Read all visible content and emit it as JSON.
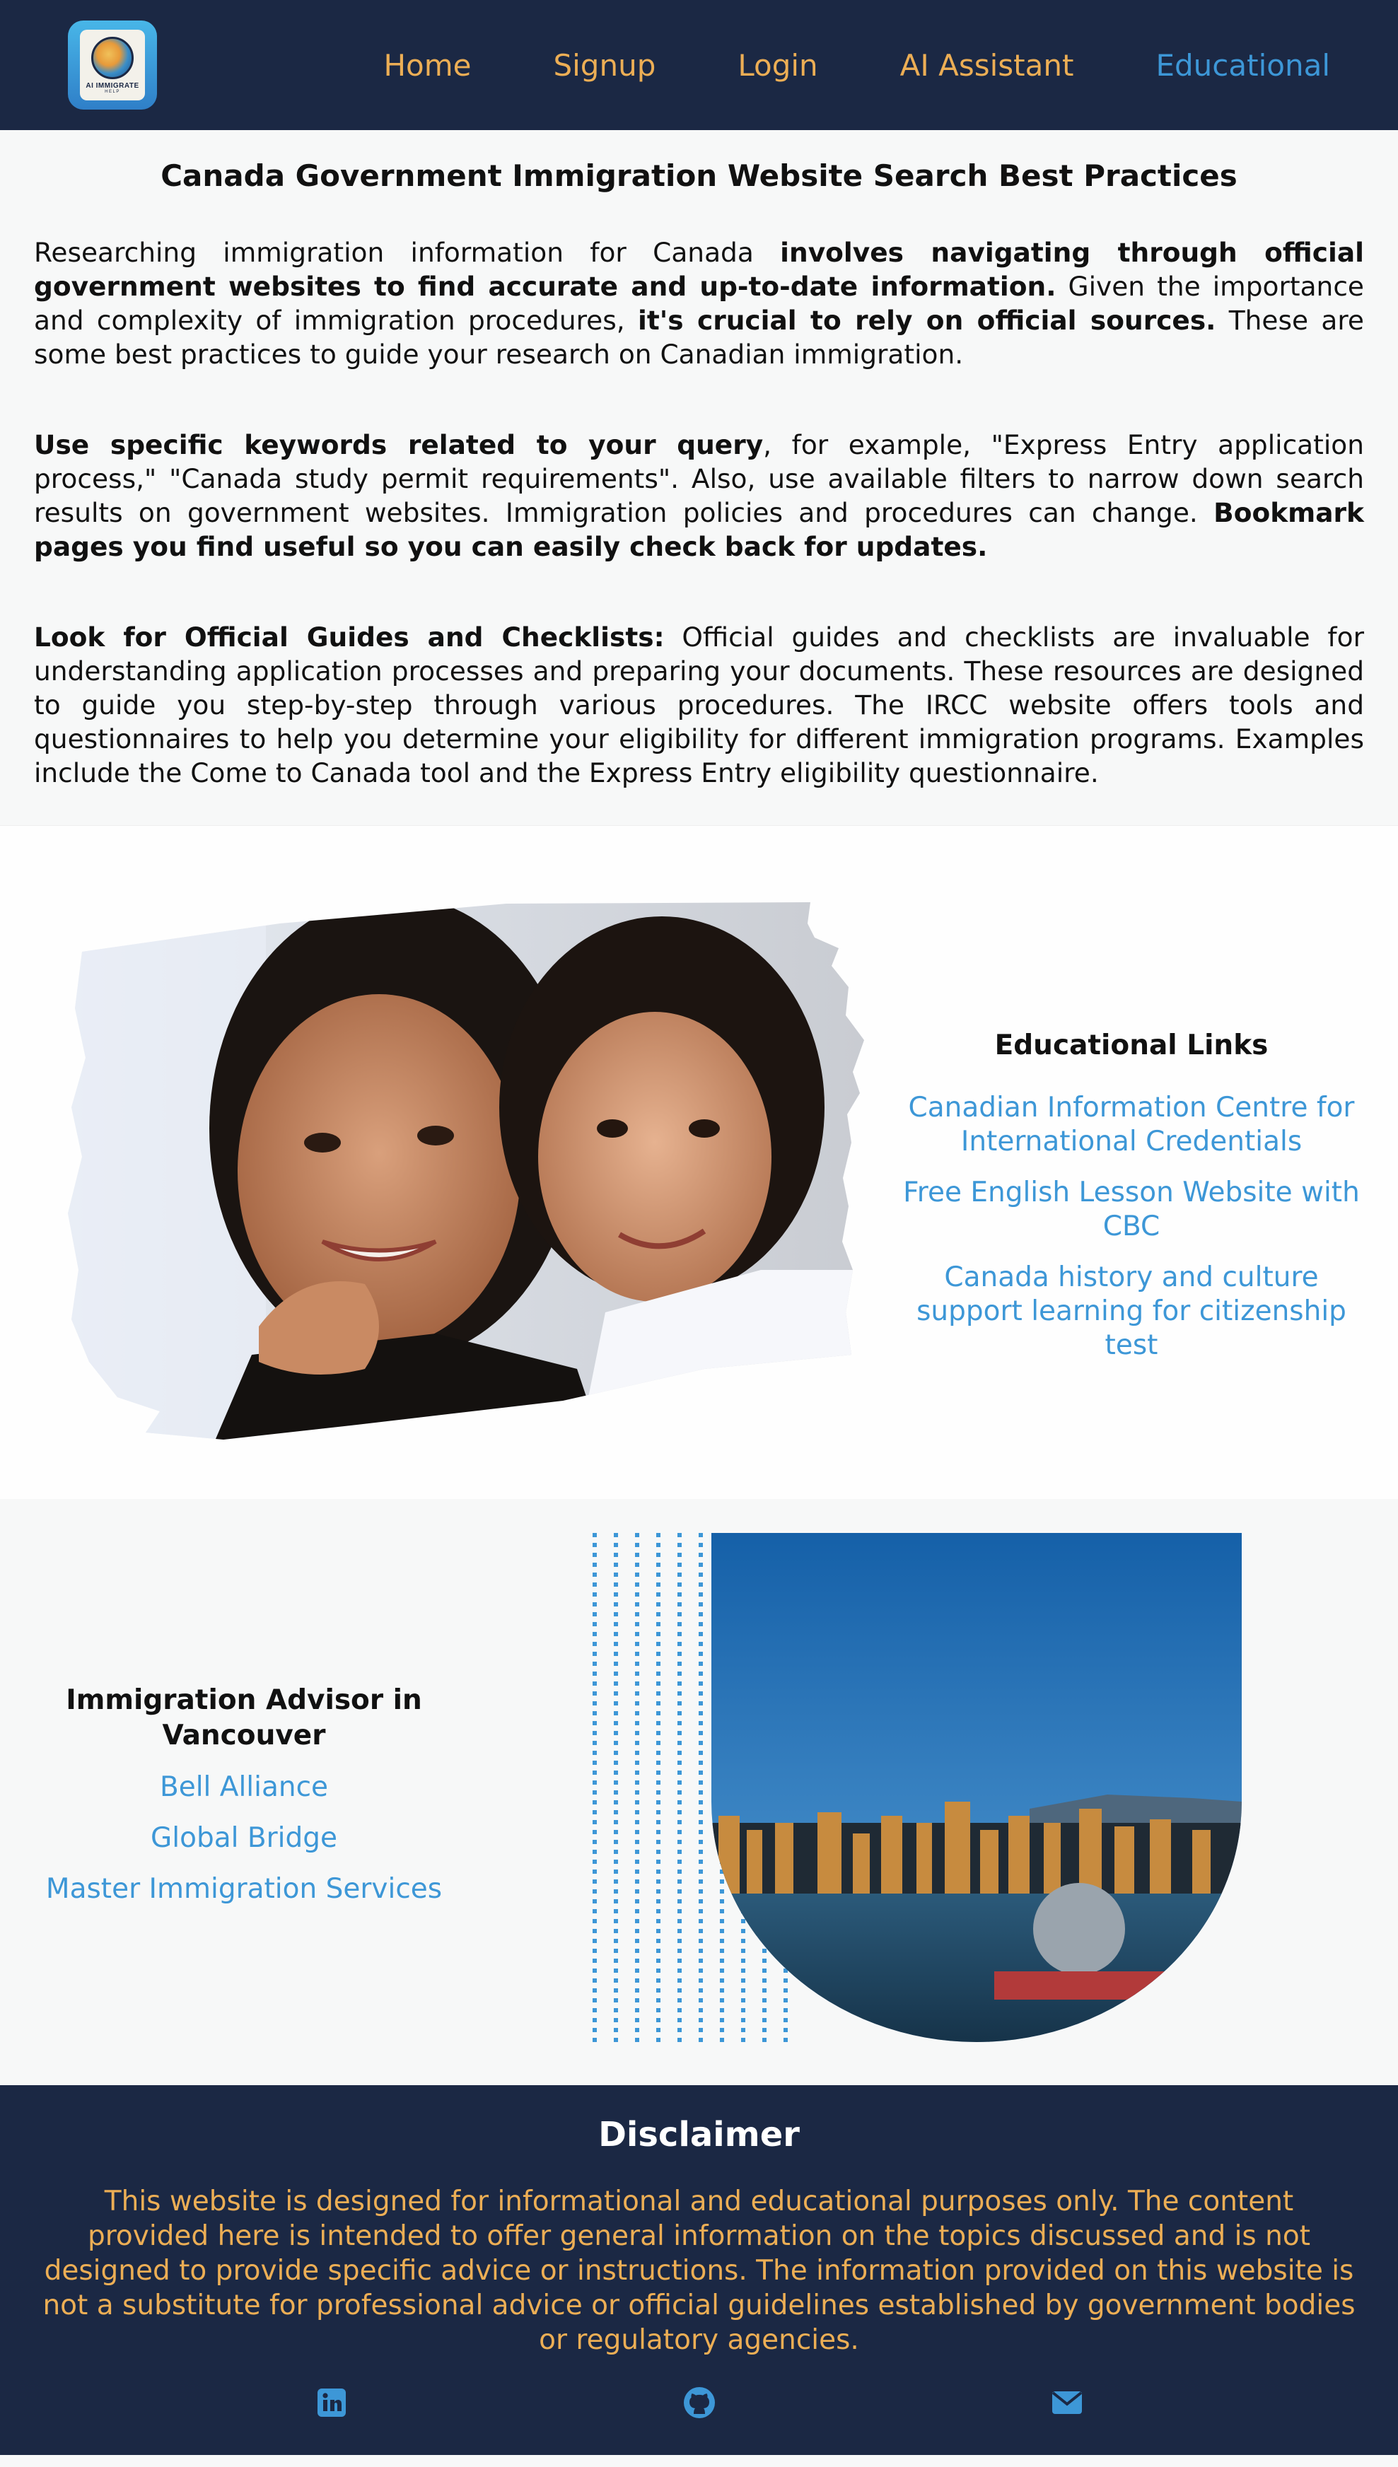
{
  "nav": {
    "logo_alt": "AI IMMIGRATE HELP",
    "logo_text": "AI IMMIGRATE",
    "logo_sub": "HELP",
    "links": [
      "Home",
      "Signup",
      "Login",
      "AI Assistant",
      "Educational"
    ],
    "active": "Educational",
    "colors": {
      "bg": "#1b2844",
      "link": "#ecae55",
      "active": "#3d97d7"
    }
  },
  "intro": {
    "title": "Canada Government Immigration Website Search Best Practices",
    "p1": {
      "a": "Researching immigration information for Canada ",
      "b": "involves navigating through official government websites to find accurate and up-to-date information.",
      "c": " Given the importance and complexity of immigration procedures, ",
      "d": "it's crucial to rely on official sources.",
      "e": " These are some best practices to guide your research on Canadian immigration."
    },
    "p2": {
      "a": "Use specific keywords related to your query",
      "b": ", for example, \"Express Entry application process,\" \"Canada study permit requirements\". Also, use available filters to narrow down search results on government websites. Immigration policies and procedures can change. ",
      "c": "Bookmark pages you find useful so you can easily check back for updates."
    },
    "p3": {
      "a": "Look for Official Guides and Checklists:",
      "b": " Official guides and checklists are invaluable for understanding application processes and preparing your documents. These resources are designed to guide you step-by-step through various procedures. The IRCC website offers tools and questionnaires to help you determine your eligibility for different immigration programs. Examples include the Come to Canada tool and the Express Entry eligibility questionnaire."
    }
  },
  "edu": {
    "title": "Educational Links",
    "links": [
      "Canadian Information Centre for International Credentials",
      "Free English Lesson Website with CBC",
      "Canada history and culture support learning for citizenship test"
    ]
  },
  "advisor": {
    "title": "Immigration Advisor in Vancouver",
    "links": [
      "Bell Alliance",
      "Global Bridge",
      "Master Immigration Services"
    ]
  },
  "footer": {
    "title": "Disclaimer",
    "text": "This website is designed for informational and educational purposes only. The content provided here is intended to offer general information on the topics discussed and is not designed to provide specific advice or instructions. The information provided on this website is not a substitute for professional advice or official guidelines established by government bodies or regulatory agencies.",
    "icons": [
      "linkedin-icon",
      "github-icon",
      "envelope-icon"
    ],
    "icon_color": "#3d97d7"
  }
}
